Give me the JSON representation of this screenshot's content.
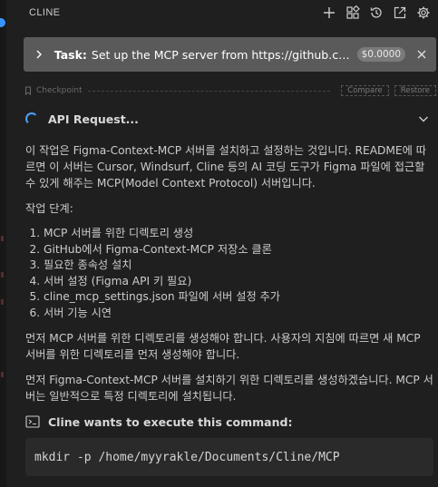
{
  "header": {
    "title": "CLINE",
    "actions": [
      {
        "icon": "plus-icon"
      },
      {
        "icon": "mcp-servers-icon"
      },
      {
        "icon": "history-icon"
      },
      {
        "icon": "open-in-editor-icon"
      },
      {
        "icon": "gear-icon"
      }
    ]
  },
  "task": {
    "label": "Task:",
    "text": "Set up the MCP server from https://github.com/GLips/Figma-Context-MCP.",
    "cost": "$0.0000"
  },
  "checkpoint": {
    "label": "Checkpoint",
    "compare": "Compare",
    "restore": "Restore"
  },
  "api_request": {
    "label": "API Request..."
  },
  "message": {
    "intro": "이 작업은 Figma-Context-MCP 서버를 설치하고 설정하는 것입니다. README에 따르면 이 서버는 Cursor, Windsurf, Cline 등의 AI 코딩 도구가 Figma 파일에 접근할 수 있게 해주는 MCP(Model Context Protocol) 서버입니다.",
    "steps_heading": "작업 단계:",
    "steps": [
      "MCP 서버를 위한 디렉토리 생성",
      "GitHub에서 Figma-Context-MCP 저장소 클론",
      "필요한 종속성 설치",
      "서버 설정 (Figma API 키 필요)",
      "cline_mcp_settings.json 파일에 서버 설정 추가",
      "서버 기능 시연"
    ],
    "para2": "먼저 MCP 서버를 위한 디렉토리를 생성해야 합니다. 사용자의 지침에 따르면 새 MCP 서버를 위한 디렉토리를 먼저 생성해야 합니다.",
    "para3": "먼저 Figma-Context-MCP 서버를 설치하기 위한 디렉토리를 생성하겠습니다. MCP 서버는 일반적으로 특정 디렉토리에 설치됩니다."
  },
  "command": {
    "title": "Cline wants to execute this command:",
    "code": "mkdir -p /home/myyrakle/Documents/Cline/MCP"
  },
  "colors": {
    "background": "#1f1f1f",
    "task_bar": "#5a5a5a",
    "spinner": "#4aa3ff",
    "code_bg": "#2a2a2a"
  }
}
